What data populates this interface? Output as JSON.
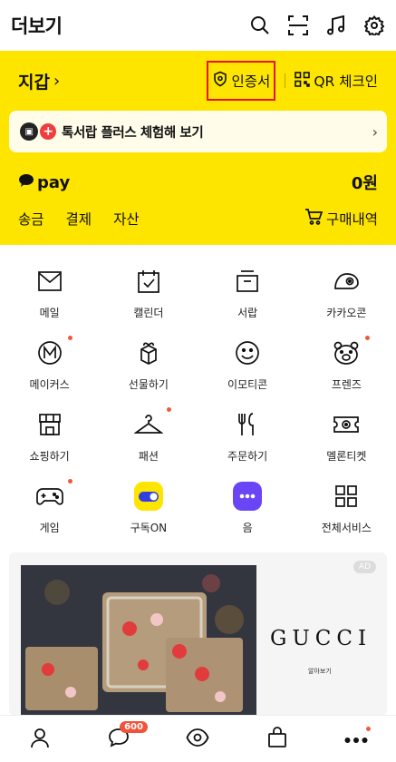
{
  "header": {
    "title": "더보기",
    "icons": [
      "search-icon",
      "scan-icon",
      "music-icon",
      "settings-icon"
    ]
  },
  "wallet": {
    "title": "지갑",
    "cert_label": "인증서",
    "qr_label": "QR 체크인",
    "promo": "톡서랍 플러스 체험해 보기",
    "pay_logo": "pay",
    "pay_amount": "0원",
    "tabs": [
      "송금",
      "결제",
      "자산"
    ],
    "purchase": "구매내역"
  },
  "grid": {
    "items": [
      {
        "label": "메일",
        "icon": "mail-icon",
        "dot": false
      },
      {
        "label": "캘린더",
        "icon": "calendar-icon",
        "dot": false
      },
      {
        "label": "서랍",
        "icon": "drawer-icon",
        "dot": false
      },
      {
        "label": "카카오콘",
        "icon": "kakaocon-icon",
        "dot": false
      },
      {
        "label": "메이커스",
        "icon": "makers-icon",
        "dot": true
      },
      {
        "label": "선물하기",
        "icon": "gift-icon",
        "dot": false
      },
      {
        "label": "이모티콘",
        "icon": "emoticon-icon",
        "dot": false
      },
      {
        "label": "프렌즈",
        "icon": "friends-icon",
        "dot": true
      },
      {
        "label": "쇼핑하기",
        "icon": "shop-icon",
        "dot": false
      },
      {
        "label": "패션",
        "icon": "hanger-icon",
        "dot": true
      },
      {
        "label": "주문하기",
        "icon": "order-icon",
        "dot": false
      },
      {
        "label": "멜론티켓",
        "icon": "ticket-icon",
        "dot": false
      },
      {
        "label": "게임",
        "icon": "game-icon",
        "dot": true
      },
      {
        "label": "구독ON",
        "icon": "subscribe-icon",
        "dot": false
      },
      {
        "label": "음",
        "icon": "eum-icon",
        "dot": false
      },
      {
        "label": "전체서비스",
        "icon": "all-services-icon",
        "dot": false
      }
    ]
  },
  "ad": {
    "brand": "GUCCI",
    "sub": "알아보기",
    "tag": "AD"
  },
  "bottom_nav": {
    "chat_count": "600"
  },
  "colors": {
    "accent": "#fee500",
    "highlight_box": "#e8121d",
    "dot": "#f05a3a"
  }
}
